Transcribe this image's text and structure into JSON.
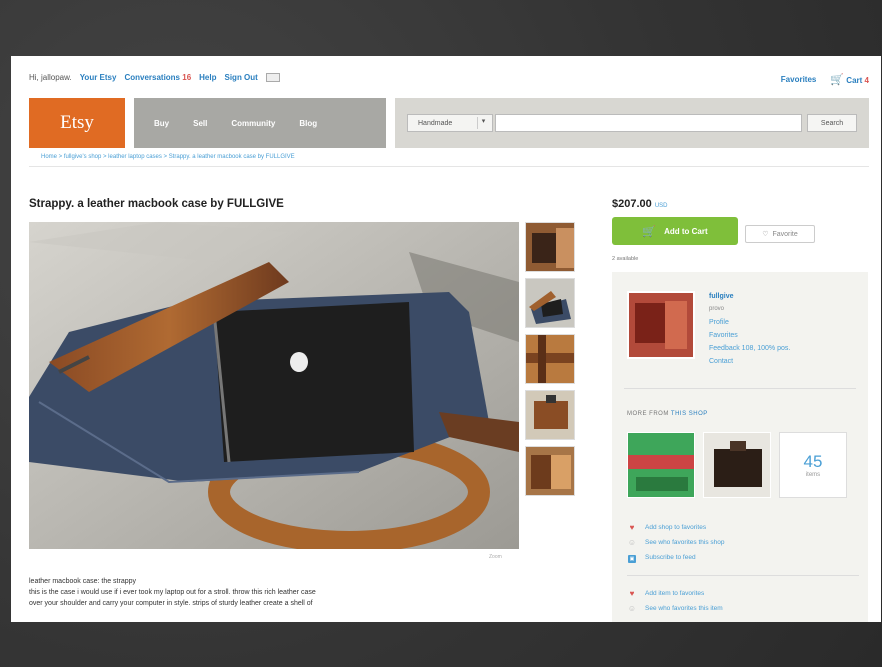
{
  "topbar": {
    "greeting": "Hi, jallopaw.",
    "your_etsy": "Your Etsy",
    "conversations": "Conversations",
    "conversations_count": "16",
    "help": "Help",
    "sign_out": "Sign Out",
    "favorites": "Favorites",
    "cart": "Cart",
    "cart_count": "4"
  },
  "header": {
    "logo": "Etsy",
    "nav": [
      "Buy",
      "Sell",
      "Community",
      "Blog"
    ],
    "search_category": "Handmade",
    "search_value": "",
    "search_button": "Search"
  },
  "breadcrumb": "Home > fullgive's shop > leather laptop cases > Strappy. a leather macbook case by FULLGIVE",
  "listing": {
    "title": "Strappy. a leather macbook case by FULLGIVE",
    "photo_credit": "Zoom",
    "description": [
      "leather macbook case: the strappy",
      "this is the case i would use if i ever took my laptop out for a stroll. throw this rich leather case",
      "over your shoulder and carry your computer in style. strips of sturdy leather create a shell of"
    ]
  },
  "purchase": {
    "price": "$207.00",
    "currency": "USD",
    "add_to_cart": "Add to Cart",
    "favorite": "Favorite",
    "available": "2 available"
  },
  "shop": {
    "name": "fullgive",
    "location": "provo",
    "links": [
      "Profile",
      "Favorites",
      "Feedback 108, 100% pos.",
      "Contact"
    ],
    "more_from_label": "MORE FROM",
    "more_from_shop": "THIS SHOP",
    "item_count": "45",
    "item_count_label": "items",
    "actions": [
      "Add shop to favorites",
      "See who favorites this shop",
      "Subscribe to feed"
    ],
    "item_actions": [
      "Add item to favorites",
      "See who favorites this item"
    ]
  },
  "icons": {
    "cart": "cart-icon",
    "heart": "heart-icon",
    "feed": "rss-icon"
  },
  "colors": {
    "etsy_orange": "#e06b23",
    "add_cart_green": "#7fbf3a",
    "link_blue": "#4a9fd5"
  }
}
